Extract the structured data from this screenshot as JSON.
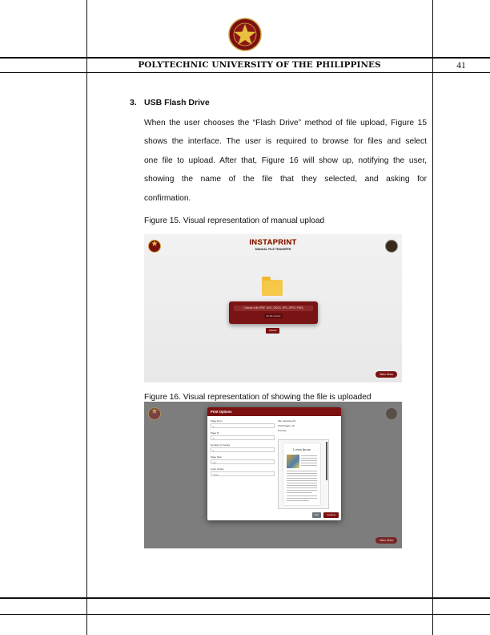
{
  "header": {
    "university": "POLYTECHNIC UNIVERSITY OF THE PHILIPPINES",
    "page_number": "41"
  },
  "section": {
    "number": "3.",
    "title": "USB Flash Drive",
    "paragraph_lines": [
      "When the user chooses the “Flash Drive” method of file upload, Figure 15",
      "shows the interface. The user is required to browse for files and select",
      "one file to upload. After that, Figure 16 will show up, notifying the user,",
      "showing the name of the file that they selected, and asking for",
      "confirmation."
    ]
  },
  "figure15": {
    "caption": "Figure 15. Visual representation of manual upload",
    "brand": "INSTAPRINT",
    "brand_sub": "MANUAL FILE TRANSFER",
    "input_text": "Choose a file (PDF, DOC, DOCX, JPG, JPEG, PNG)",
    "no_file": "No file chosen",
    "upload_label": "Upload",
    "video_label": "Video Demo",
    "icons": [
      "pup-seal-icon",
      "folder-icon",
      "usb-logo-icon"
    ]
  },
  "figure16": {
    "caption": "Figure 16. Visual representation of showing the file is uploaded",
    "modal_title": "Print Options",
    "fields": [
      {
        "label": "Page From",
        "value": "1"
      },
      {
        "label": "Page To",
        "value": "5"
      },
      {
        "label": "Number of Copies",
        "value": "1"
      },
      {
        "label": "Page Size",
        "value": "A4"
      },
      {
        "label": "Color Option",
        "value": "Color"
      }
    ],
    "file_name": "File: Sample.pdf",
    "total_pages": "Total Pages: 10",
    "preview_label": "Preview",
    "preview_title": "Lorem Ipsum",
    "exit_label": "Exit",
    "continue_label": "Continue",
    "video_label": "Video Demo"
  },
  "colors": {
    "maroon": "#7a1010",
    "gold": "#e8c040",
    "overlay_gray": "#7d7d7d"
  }
}
